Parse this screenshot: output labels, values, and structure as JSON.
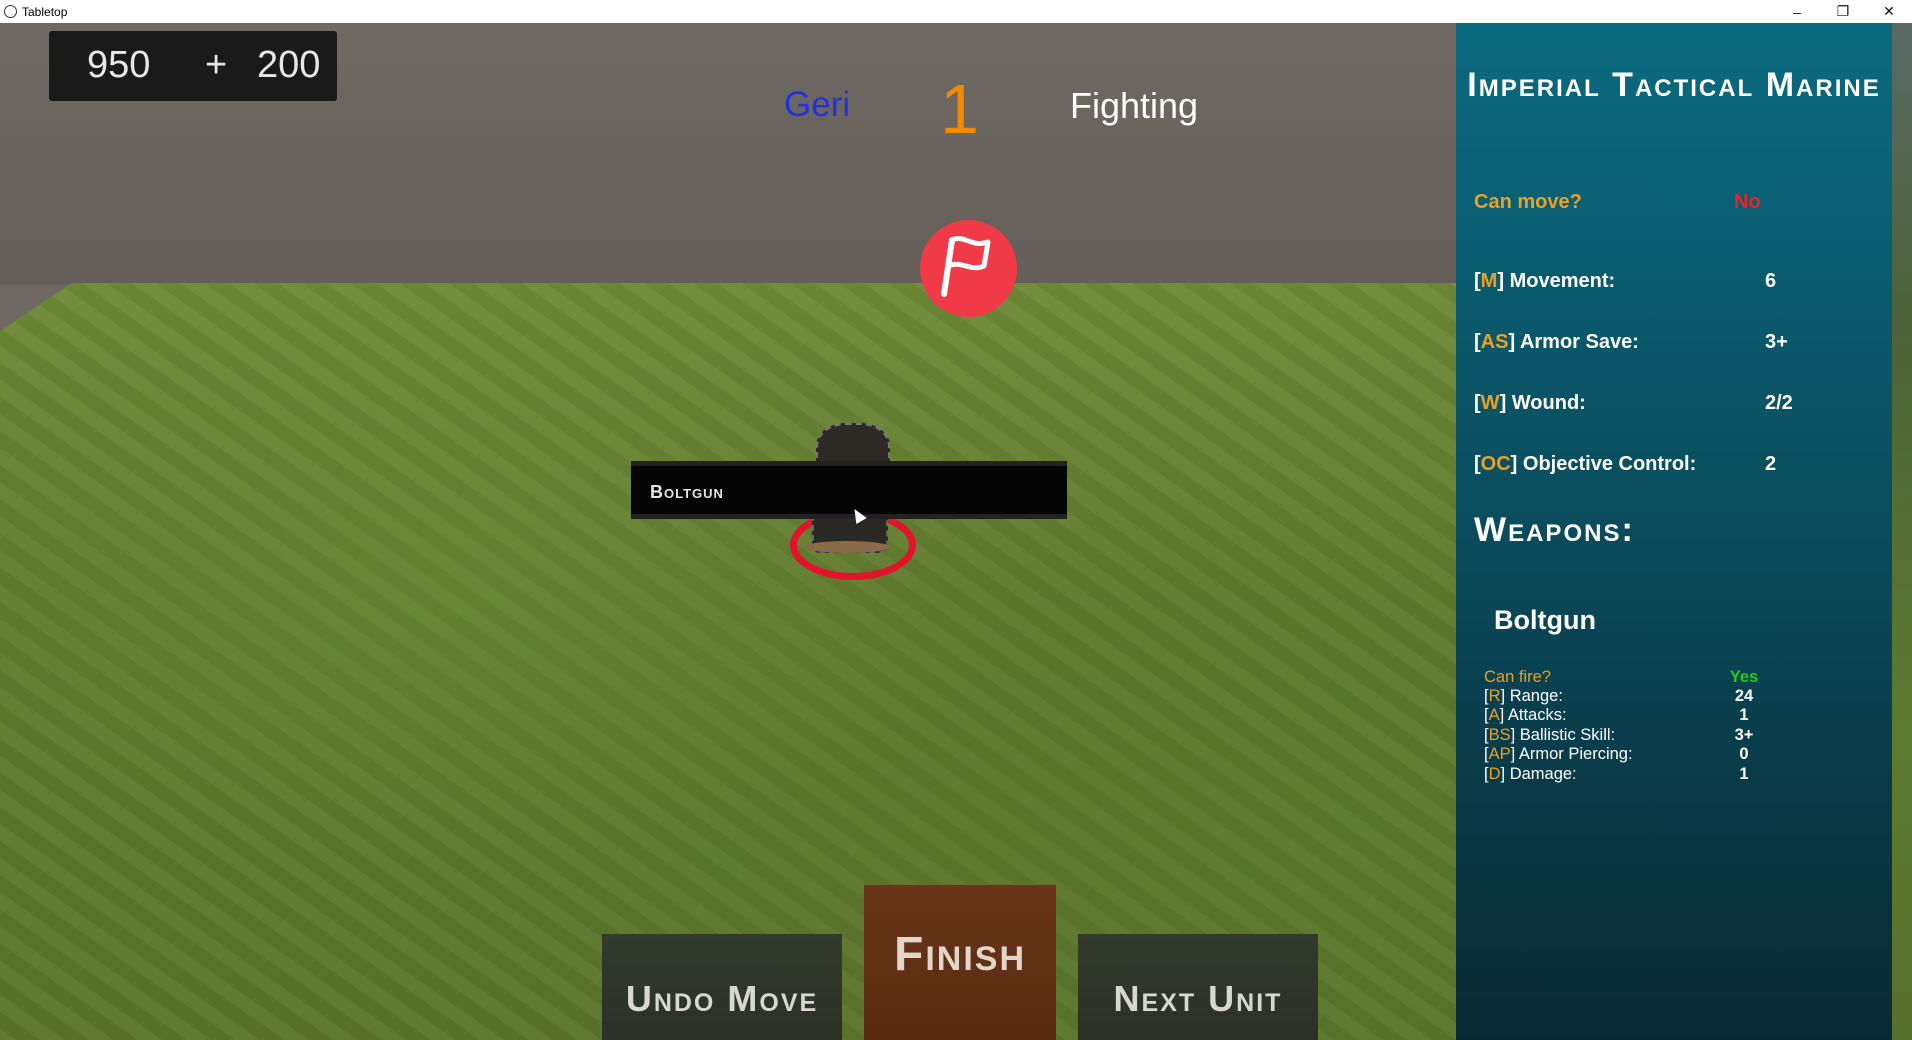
{
  "window": {
    "title": "Tabletop",
    "minimize": "–",
    "restore": "❐",
    "close": "✕"
  },
  "hud": {
    "score_base": "950",
    "score_plus": "+",
    "score_bonus": "200",
    "player_name": "Geri",
    "turn_number": "1",
    "phase": "Fighting"
  },
  "weapon_tooltip": "Boltgun",
  "actions": {
    "undo": "Undo Move",
    "finish": "Finish",
    "next": "Next Unit"
  },
  "panel": {
    "unit_name": "Imperial Tactical Marine",
    "can_move_label": "Can move?",
    "can_move_value": "No",
    "stats": [
      {
        "lb": "[",
        "abbr": "M",
        "rb": "]",
        "label": " Movement:",
        "value": "6"
      },
      {
        "lb": "[",
        "abbr": "AS",
        "rb": "]",
        "label": " Armor Save:",
        "value": "3+"
      },
      {
        "lb": "[",
        "abbr": "W",
        "rb": "]",
        "label": " Wound:",
        "value": "2/2"
      },
      {
        "lb": "[",
        "abbr": "OC",
        "rb": "]",
        "label": " Objective Control:",
        "value": "2"
      }
    ],
    "weapons_title": "Weapons:",
    "weapon": {
      "name": "Boltgun",
      "can_fire_label": "Can fire?",
      "can_fire_value": "Yes",
      "stats": [
        {
          "abbr": "R",
          "label": " Range:",
          "value": "24"
        },
        {
          "abbr": "A",
          "label": " Attacks:",
          "value": "1"
        },
        {
          "abbr": "BS",
          "label": " Ballistic Skill:",
          "value": "3+"
        },
        {
          "abbr": "AP",
          "label": " Armor Piercing:",
          "value": "0"
        },
        {
          "abbr": "D",
          "label": " Damage:",
          "value": "1"
        }
      ]
    }
  },
  "colors": {
    "player": "#2233dd",
    "turn": "#f28a00",
    "accent": "#e9a024",
    "negative": "#ee2222",
    "positive": "#22cc22",
    "objective": "#f03a48",
    "selection": "#e4122a"
  },
  "icons": {
    "objective_marker": "flag-icon",
    "app": "app-icon",
    "cursor": "cursor-icon"
  }
}
